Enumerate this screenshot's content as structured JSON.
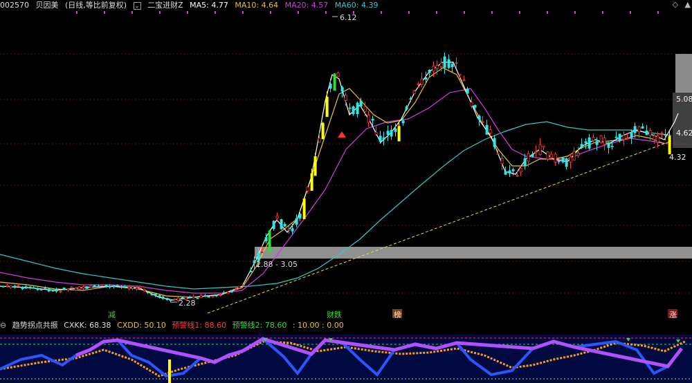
{
  "header": {
    "code": "002570",
    "name": "贝因美",
    "mode": "(日线,等比前复权)",
    "indicator": "二宝进财Z",
    "ma5": "MA5: 4.77",
    "ma10": "MA10: 4.64",
    "ma20": "MA20: 4.57",
    "ma60": "MA60: 4.39"
  },
  "labels": {
    "high": "6.12",
    "low": "2.28",
    "band": "2.88 - 3.05",
    "r1": "5.08",
    "r2": "4.62",
    "r3": "4.32"
  },
  "marks": {
    "m1": "减",
    "m2": "财跌",
    "m3": "榜",
    "m4": "涨"
  },
  "sub": {
    "name": "趋势拐点共振",
    "cxkk": "CXKK: 68.38",
    "cxdd": "CXDD: 50.10",
    "warn1": "预警线1: 88.60",
    "warn2": "预警线2: 78.60",
    "extra": ": 10.00 : 0.00"
  },
  "colors": {
    "up": "#ff3b3b",
    "down": "#33e5e5",
    "ma5": "#ffffff",
    "ma10": "#e5c62e",
    "ma20": "#d23ce0",
    "ma60": "#34c8c8",
    "yellow": "#ffff00",
    "green": "#33dd33"
  },
  "icons": [
    "diamond-icon",
    "collapse-icon"
  ]
}
